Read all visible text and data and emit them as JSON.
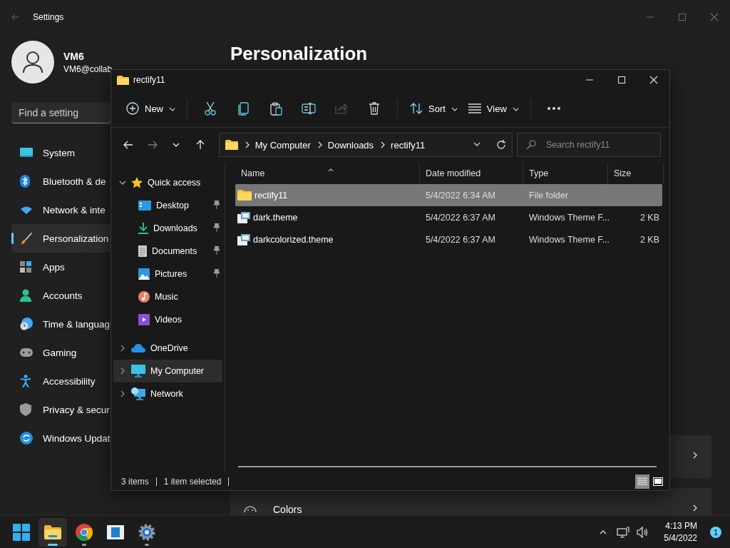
{
  "settings": {
    "title": "Settings",
    "user": {
      "name": "VM6",
      "email": "VM6@collab"
    },
    "search": {
      "placeholder": "Find a setting"
    },
    "nav": [
      {
        "kind": "system",
        "label": "System",
        "selected": false
      },
      {
        "kind": "bluetooth",
        "label": "Bluetooth & de",
        "selected": false
      },
      {
        "kind": "network",
        "label": "Network & inte",
        "selected": false
      },
      {
        "kind": "personalization",
        "label": "Personalization",
        "selected": true
      },
      {
        "kind": "apps",
        "label": "Apps",
        "selected": false
      },
      {
        "kind": "accounts",
        "label": "Accounts",
        "selected": false
      },
      {
        "kind": "time",
        "label": "Time & languag",
        "selected": false
      },
      {
        "kind": "gaming",
        "label": "Gaming",
        "selected": false
      },
      {
        "kind": "accessibility",
        "label": "Accessibility",
        "selected": false
      },
      {
        "kind": "privacy",
        "label": "Privacy & secur",
        "selected": false
      },
      {
        "kind": "update",
        "label": "Windows Updat",
        "selected": false
      }
    ],
    "heading": "Personalization",
    "cards": [
      {
        "kind": "blank"
      },
      {
        "kind": "colors",
        "label": "Colors"
      }
    ]
  },
  "explorer": {
    "title": "rectify11",
    "toolbar": [
      {
        "kind": "new",
        "label": "New",
        "disabled": false
      },
      {
        "kind": "separator"
      },
      {
        "kind": "cut",
        "disabled": false
      },
      {
        "kind": "copy",
        "disabled": false
      },
      {
        "kind": "paste",
        "disabled": false
      },
      {
        "kind": "rename",
        "disabled": false
      },
      {
        "kind": "share",
        "disabled": true
      },
      {
        "kind": "delete",
        "disabled": false
      },
      {
        "kind": "separator"
      },
      {
        "kind": "sort",
        "label": "Sort",
        "disabled": false
      },
      {
        "kind": "view",
        "label": "View",
        "disabled": false
      },
      {
        "kind": "separator"
      },
      {
        "kind": "more",
        "disabled": false
      }
    ],
    "nav_buttons": [
      {
        "kind": "back",
        "disabled": false
      },
      {
        "kind": "forward",
        "disabled": true
      },
      {
        "kind": "recent",
        "disabled": false
      },
      {
        "kind": "up",
        "disabled": false
      }
    ],
    "address": {
      "segments": [
        "My Computer",
        "Downloads",
        "rectify11"
      ]
    },
    "search": {
      "placeholder": "Search rectify11"
    },
    "tree": [
      {
        "kind": "star",
        "label": "Quick access",
        "expanded": true,
        "selected": false,
        "children": [
          {
            "kind": "desktop",
            "label": "Desktop",
            "pinned": true,
            "selected": false
          },
          {
            "kind": "downloads",
            "label": "Downloads",
            "pinned": true,
            "selected": false
          },
          {
            "kind": "documents",
            "label": "Documents",
            "pinned": true,
            "selected": false
          },
          {
            "kind": "pictures",
            "label": "Pictures",
            "pinned": true,
            "selected": false
          },
          {
            "kind": "music",
            "label": "Music",
            "pinned": false,
            "selected": false
          },
          {
            "kind": "videos",
            "label": "Videos",
            "pinned": false,
            "selected": false
          }
        ]
      },
      {
        "kind": "cloud",
        "label": "OneDrive",
        "expanded": false,
        "selected": false
      },
      {
        "kind": "computer",
        "label": "My Computer",
        "expanded": false,
        "selected": true
      },
      {
        "kind": "network",
        "label": "Network",
        "expanded": false,
        "selected": false
      }
    ],
    "columns": [
      {
        "label": "Name",
        "sorted": true
      },
      {
        "label": "Date modified",
        "sorted": false
      },
      {
        "label": "Type",
        "sorted": false
      },
      {
        "label": "Size",
        "sorted": false
      }
    ],
    "rows": [
      {
        "kind": "folder",
        "name": "rectify11",
        "date": "5/4/2022 6:34 AM",
        "type": "File folder",
        "selected": true
      },
      {
        "kind": "theme",
        "name": "dark.theme",
        "date": "5/4/2022 6:37 AM",
        "type": "Windows Theme F...",
        "size": "2 KB",
        "selected": false
      },
      {
        "kind": "theme",
        "name": "darkcolorized.theme",
        "date": "5/4/2022 6:37 AM",
        "type": "Windows Theme F...",
        "size": "2 KB",
        "selected": false
      }
    ],
    "status": {
      "count": "3 items",
      "selection": "1 item selected"
    },
    "view_buttons": [
      {
        "kind": "details",
        "selected": true
      },
      {
        "kind": "tiles",
        "selected": false
      }
    ]
  },
  "taskbar": {
    "apps": [
      {
        "kind": "start",
        "running": false,
        "active": false
      },
      {
        "kind": "explorer",
        "running": true,
        "active": true
      },
      {
        "kind": "chrome",
        "running": true,
        "active": false
      },
      {
        "kind": "media",
        "running": false,
        "active": false
      },
      {
        "kind": "settings",
        "running": true,
        "active": false
      }
    ],
    "time": "4:13 PM",
    "date": "5/4/2022",
    "notifications": "1"
  }
}
